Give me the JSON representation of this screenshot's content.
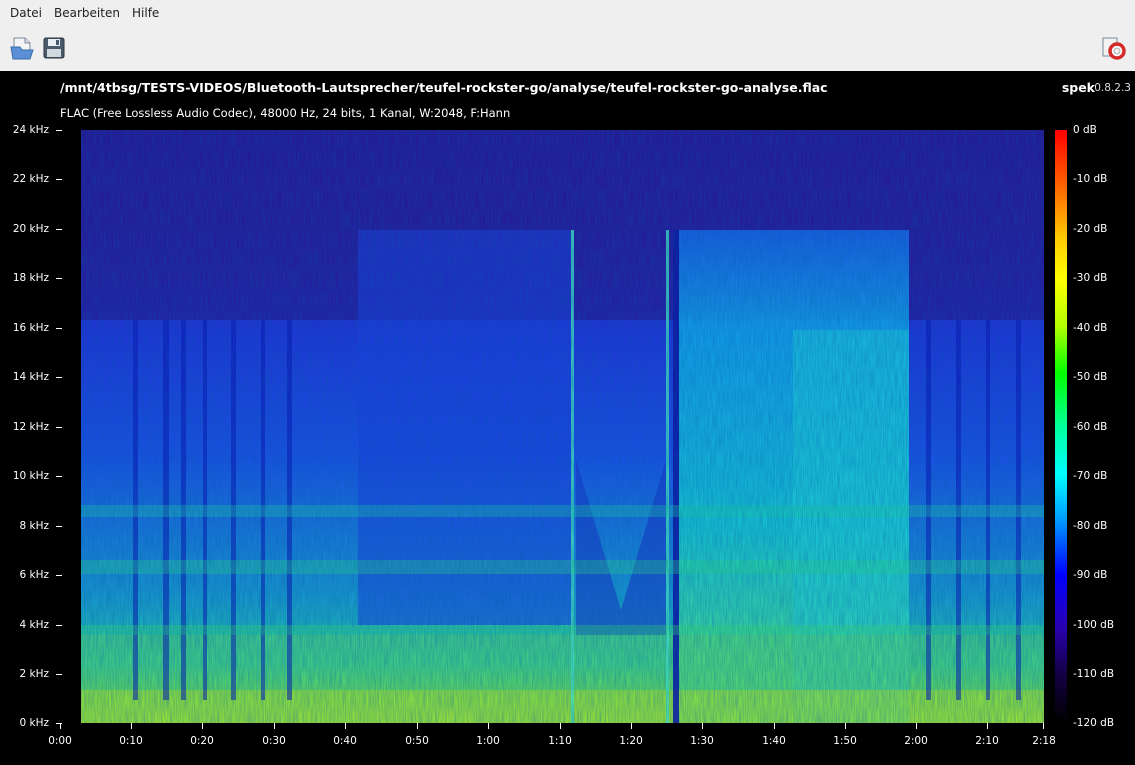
{
  "menu": {
    "items": [
      "Datei",
      "Bearbeiten",
      "Hilfe"
    ]
  },
  "toolbar": {
    "open_icon": "open-file-icon",
    "save_icon": "save-icon",
    "help_icon": "help-lifebuoy-icon"
  },
  "header": {
    "file_path": "/mnt/4tbsg/TESTS-VIDEOS/Bluetooth-Lautsprecher/teufel-rockster-go/analyse/teufel-rockster-go-analyse.flac",
    "app_name": "spek",
    "app_version": "0.8.2.3",
    "stream_info": "FLAC (Free Lossless Audio Codec), 48000 Hz, 24 bits, 1 Kanal, W:2048, F:Hann"
  },
  "axes": {
    "frequency_labels": [
      "24 kHz",
      "22 kHz",
      "20 kHz",
      "18 kHz",
      "16 kHz",
      "14 kHz",
      "12 kHz",
      "10 kHz",
      "8 kHz",
      "6 kHz",
      "4 kHz",
      "2 kHz",
      "0 kHz"
    ],
    "time_labels": [
      "0:00",
      "0:10",
      "0:20",
      "0:30",
      "0:40",
      "0:50",
      "1:00",
      "1:10",
      "1:20",
      "1:30",
      "1:40",
      "1:50",
      "2:00",
      "2:10",
      "2:18"
    ],
    "db_labels": [
      "0 dB",
      "-10 dB",
      "-20 dB",
      "-30 dB",
      "-40 dB",
      "-50 dB",
      "-60 dB",
      "-70 dB",
      "-80 dB",
      "-90 dB",
      "-100 dB",
      "-110 dB",
      "-120 dB"
    ]
  },
  "colors": {
    "background": "#000000",
    "chrome": "#efefef"
  }
}
